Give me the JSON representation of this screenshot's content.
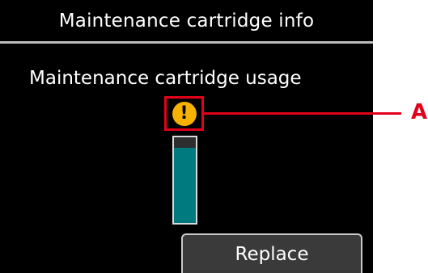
{
  "header": {
    "title": "Maintenance cartridge info"
  },
  "main": {
    "usage_label": "Maintenance cartridge usage",
    "usage_level": 0.88,
    "warning_icon": "exclamation-warning-icon"
  },
  "callout": {
    "label": "A"
  },
  "actions": {
    "replace_label": "Replace"
  },
  "colors": {
    "screen_bg": "#000000",
    "gauge_fill": "#007a7e",
    "warning_icon": "#f7b100",
    "highlight": "#e2001a"
  }
}
